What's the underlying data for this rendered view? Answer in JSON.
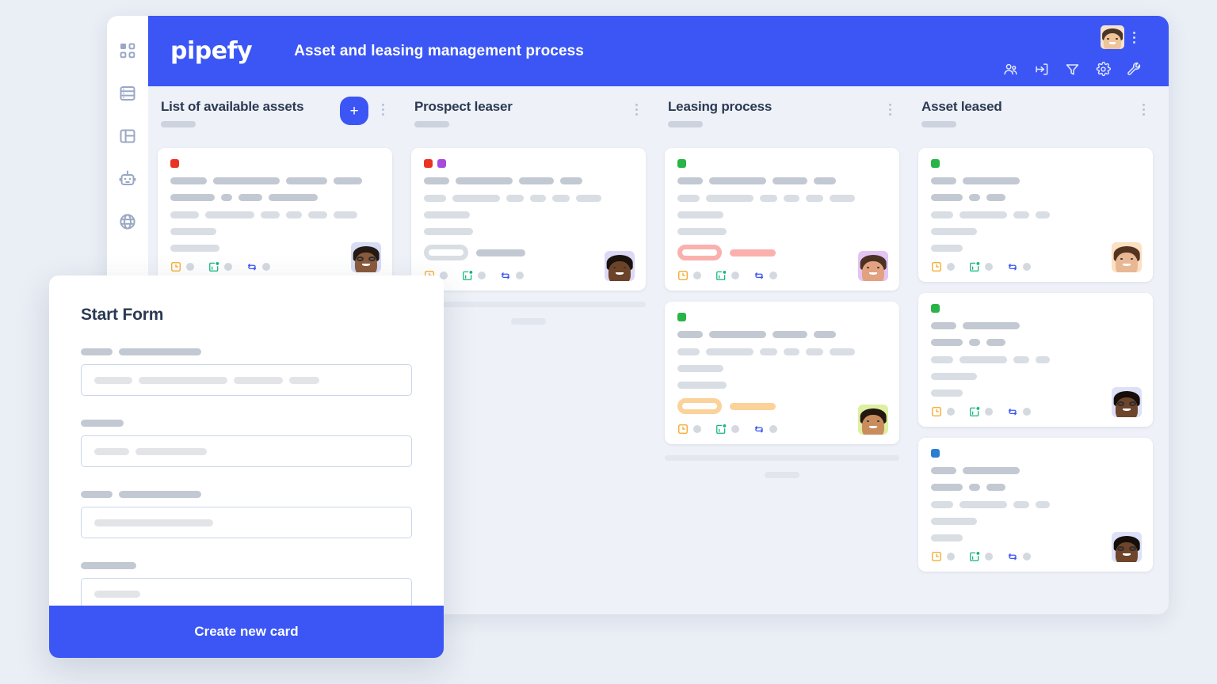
{
  "app": {
    "logo_text": "pipefy",
    "board_title": "Asset and leasing management process"
  },
  "sidebar": {
    "items": [
      {
        "icon": "grid-dashboard-icon",
        "name": "sidebar-item-dashboard"
      },
      {
        "icon": "database-icon",
        "name": "sidebar-item-database"
      },
      {
        "icon": "board-layout-icon",
        "name": "sidebar-item-board"
      },
      {
        "icon": "robot-automation-icon",
        "name": "sidebar-item-automations"
      },
      {
        "icon": "globe-icon",
        "name": "sidebar-item-public"
      }
    ]
  },
  "header": {
    "actions": [
      {
        "icon": "members-icon",
        "name": "header-members-button"
      },
      {
        "icon": "import-icon",
        "name": "header-import-button"
      },
      {
        "icon": "filter-icon",
        "name": "header-filter-button"
      },
      {
        "icon": "gear-icon",
        "name": "header-settings-button"
      },
      {
        "icon": "wrench-icon",
        "name": "header-tools-button"
      }
    ],
    "avatar": "user-avatar",
    "kebab": "header-more-menu"
  },
  "board": {
    "columns": [
      {
        "title": "List of available assets",
        "has_add_button": true,
        "add_label": "+",
        "cards": [
          {
            "labels": [
              "#ea3323"
            ],
            "avatar_skin": "#8a5a3b",
            "avatar_hair": "#231a14",
            "avatar_bg": "#d7dcf5",
            "avatar_glasses": true,
            "badge": null
          }
        ],
        "dropzone": false
      },
      {
        "title": "Prospect leaser",
        "has_add_button": false,
        "cards": [
          {
            "labels": [
              "#ea3323",
              "#a64bdd"
            ],
            "avatar_skin": "#6b4329",
            "avatar_hair": "#1a120c",
            "avatar_bg": "#dcd9f7",
            "avatar_glasses": false,
            "badge": "grey"
          }
        ],
        "dropzone": true
      },
      {
        "title": "Leasing process",
        "has_add_button": false,
        "cards": [
          {
            "labels": [
              "#28b446"
            ],
            "avatar_skin": "#e2a180",
            "avatar_hair": "#4a3122",
            "avatar_bg": "#e4c4f3",
            "avatar_glasses": false,
            "badge": "red"
          },
          {
            "labels": [
              "#28b446"
            ],
            "avatar_skin": "#c98c5d",
            "avatar_hair": "#241710",
            "avatar_bg": "#ddf0a1",
            "avatar_glasses": false,
            "badge": "orange"
          }
        ],
        "dropzone": true
      },
      {
        "title": "Asset leased",
        "has_add_button": false,
        "cards": [
          {
            "labels": [
              "#28b446"
            ],
            "avatar_skin": "#e8b894",
            "avatar_hair": "#54341f",
            "avatar_bg": "#fbe0c2",
            "avatar_glasses": false,
            "badge": null
          },
          {
            "labels": [
              "#28b446"
            ],
            "avatar_skin": "#6e452a",
            "avatar_hair": "#150e09",
            "avatar_bg": "#dde0f7",
            "avatar_glasses": true,
            "badge": null
          },
          {
            "labels": [
              "#2b7ed1"
            ],
            "avatar_skin": "#6e452a",
            "avatar_hair": "#150e09",
            "avatar_bg": "#dde0f7",
            "avatar_glasses": true,
            "badge": null
          }
        ],
        "dropzone": false
      }
    ],
    "card_meta_icons": [
      {
        "icon": "due-date-clock-icon",
        "color": "#f5a623"
      },
      {
        "icon": "checklist-calendar-icon",
        "color": "#15b77c"
      },
      {
        "icon": "connected-cards-icon",
        "color": "#3b56f5"
      }
    ]
  },
  "modal": {
    "title": "Start Form",
    "submit_label": "Create new card",
    "fields": [
      {
        "label_bars": [
          40,
          104
        ],
        "input_bars": [
          48,
          112,
          62,
          38
        ]
      },
      {
        "label_bars": [
          54
        ],
        "input_bars": [
          44,
          90
        ]
      },
      {
        "label_bars": [
          40,
          104
        ],
        "input_bars": [
          150
        ]
      },
      {
        "label_bars": [
          70
        ],
        "input_bars": [
          58
        ]
      }
    ]
  },
  "colors": {
    "brand_blue": "#3b56f5",
    "page_bg": "#eaeef5",
    "board_bg": "#eef1f7",
    "card_bg": "#ffffff",
    "title_text": "#2b3a52",
    "skeleton_dark": "#c3c9d3",
    "skeleton_light": "#d9dde4",
    "label_red": "#ea3323",
    "label_purple": "#a64bdd",
    "label_green": "#28b446",
    "label_blue": "#2b7ed1",
    "badge_red": "#fab1ae",
    "badge_orange": "#fbd29a"
  }
}
